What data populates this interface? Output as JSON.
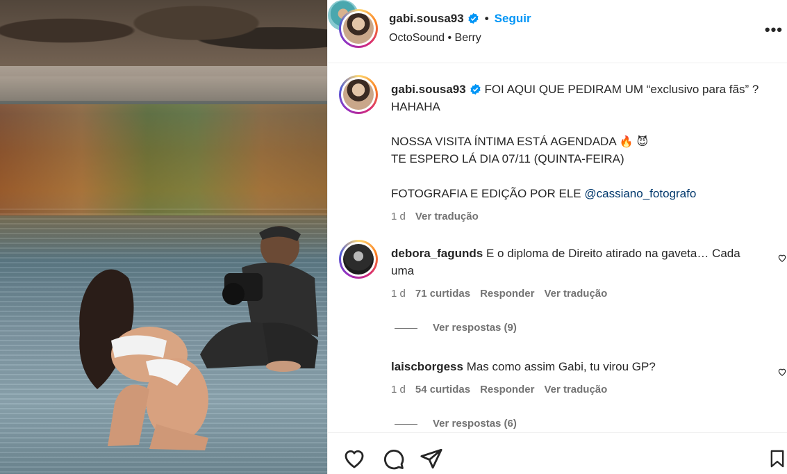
{
  "post": {
    "username": "gabi.sousa93",
    "follow_label": "Seguir",
    "separator": "•",
    "audio": "OctoSound • Berry",
    "more_label": "•••"
  },
  "caption": {
    "username": "gabi.sousa93",
    "line1": "FOI AQUI QUE PEDIRAM UM “exclusivo para fãs” ? HAHAHA",
    "line2": "NOSSA VISITA ÍNTIMA ESTÁ AGENDADA",
    "line2_emojis": "🔥 😈",
    "line3": "TE ESPERO LÁ DIA 07/11 (QUINTA-FEIRA)",
    "line4_prefix": "FOTOGRAFIA E EDIÇÃO POR ELE ",
    "mention": "@cassiano_fotografo",
    "time": "1 d",
    "translate": "Ver tradução"
  },
  "comments": [
    {
      "username": "debora_fagunds",
      "text": "E o diploma de Direito atirado na gaveta… Cada uma",
      "time": "1 d",
      "likes": "71 curtidas",
      "reply": "Responder",
      "translate": "Ver tradução",
      "view_replies": "Ver respostas (9)"
    },
    {
      "username": "laiscborgess",
      "text": "Mas como assim Gabi, tu virou GP?",
      "time": "1 d",
      "likes": "54 curtidas",
      "reply": "Responder",
      "translate": "Ver tradução",
      "view_replies": "Ver respostas (6)"
    }
  ],
  "icons": {
    "like": "heart-icon",
    "comment": "comment-icon",
    "share": "send-icon",
    "save": "bookmark-icon",
    "verified": "verified-badge-icon",
    "more": "more-options-icon"
  },
  "colors": {
    "link": "#0095f6",
    "mention": "#00376b",
    "muted": "#737373",
    "text": "#262626"
  }
}
